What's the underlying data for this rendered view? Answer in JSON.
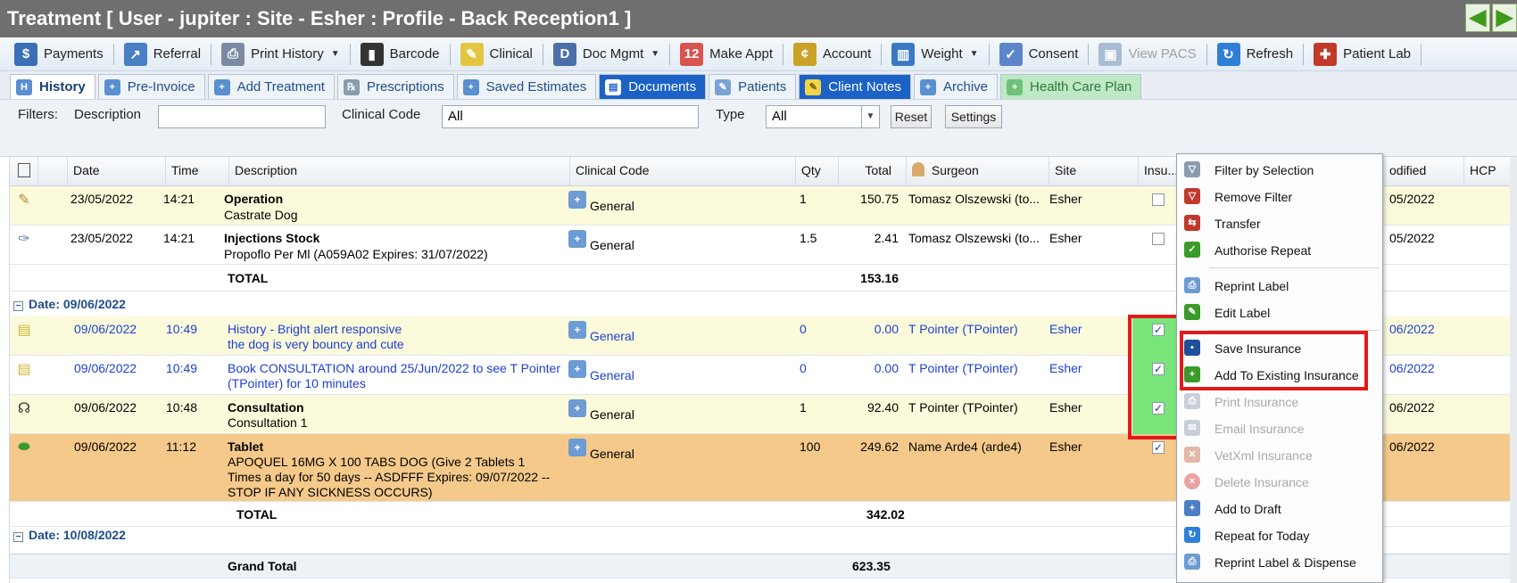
{
  "window": {
    "title": "Treatment [ User - jupiter : Site - Esher : Profile - Back Reception1 ]"
  },
  "toolbar": {
    "items": [
      {
        "label": "Payments",
        "icon": "payments-icon",
        "color": "#3b6fb6"
      },
      {
        "label": "Referral",
        "icon": "referral-icon",
        "color": "#4a7fc4"
      },
      {
        "label": "Print History",
        "icon": "print-history-icon",
        "color": "#7b8aa0"
      },
      {
        "label": "Barcode",
        "icon": "barcode-icon",
        "color": "#333333"
      },
      {
        "label": "Clinical",
        "icon": "clinical-notepad-icon",
        "color": "#e3c542"
      },
      {
        "label": "Doc Mgmt",
        "icon": "doc-mgmt-icon",
        "color": "#4b6fa8"
      },
      {
        "label": "Make Appt",
        "icon": "calendar-icon",
        "color": "#d9534f"
      },
      {
        "label": "Account",
        "icon": "account-coins-icon",
        "color": "#c9a227"
      },
      {
        "label": "Weight",
        "icon": "weight-chart-icon",
        "color": "#3a78c2"
      },
      {
        "label": "Consent",
        "icon": "consent-pen-icon",
        "color": "#5b86c9"
      },
      {
        "label": "View PACS",
        "icon": "pacs-image-icon",
        "color": "#a9bcd2"
      },
      {
        "label": "Refresh",
        "icon": "refresh-icon",
        "color": "#2f7fd6"
      },
      {
        "label": "Patient Lab",
        "icon": "patient-lab-icon",
        "color": "#c0392b"
      }
    ]
  },
  "tabs": [
    {
      "label": "History"
    },
    {
      "label": "Pre-Invoice"
    },
    {
      "label": "Add Treatment"
    },
    {
      "label": "Prescriptions"
    },
    {
      "label": "Saved Estimates"
    },
    {
      "label": "Documents"
    },
    {
      "label": "Patients"
    },
    {
      "label": "Client Notes"
    },
    {
      "label": "Archive"
    },
    {
      "label": "Health Care Plan"
    }
  ],
  "filters": {
    "label": "Filters:",
    "description_label": "Description",
    "description_value": "",
    "clinical_code_label": "Clinical Code",
    "clinical_code_value": "All",
    "type_label": "Type",
    "type_value": "All",
    "reset_label": "Reset",
    "settings_label": "Settings"
  },
  "grid": {
    "columns": [
      "Date",
      "Time",
      "Description",
      "Clinical Code",
      "Qty",
      "Total",
      "Surgeon",
      "Site",
      "Insu...",
      "odified",
      "HCP"
    ],
    "rows_group1": [
      {
        "date": "23/05/2022",
        "time": "14:21",
        "desc_title": "Operation",
        "desc_sub": "Castrate Dog",
        "code": "General",
        "qty": "1",
        "total": "150.75",
        "surgeon": "Tomasz Olszewski (to...",
        "site": "Esher",
        "modified": "05/2022"
      },
      {
        "date": "23/05/2022",
        "time": "14:21",
        "desc_title": "Injections Stock",
        "desc_sub": "Propoflo Per Ml (A059A02 Expires: 31/07/2022)",
        "code": "General",
        "qty": "1.5",
        "total": "2.41",
        "surgeon": "Tomasz Olszewski (to...",
        "site": "Esher",
        "modified": "05/2022"
      }
    ],
    "total1_label": "TOTAL",
    "total1_value": "153.16",
    "group2_label": "Date: 09/06/2022",
    "rows_group2": [
      {
        "date": "09/06/2022",
        "time": "10:49",
        "desc_line1": "History - Bright alert responsive",
        "desc_line2": "the dog is very bouncy and cute",
        "code": "General",
        "qty": "0",
        "total": "0.00",
        "surgeon": "T Pointer (TPointer)",
        "site": "Esher",
        "modified": "06/2022"
      },
      {
        "date": "09/06/2022",
        "time": "10:49",
        "desc_line1": "Book CONSULTATION around 25/Jun/2022 to see T Pointer",
        "desc_line2": "(TPointer) for 10 minutes",
        "code": "General",
        "qty": "0",
        "total": "0.00",
        "surgeon": "T Pointer (TPointer)",
        "site": "Esher",
        "modified": "06/2022"
      },
      {
        "date": "09/06/2022",
        "time": "10:48",
        "desc_title": "Consultation",
        "desc_sub": "Consultation 1",
        "code": "General",
        "qty": "1",
        "total": "92.40",
        "surgeon": "T Pointer (TPointer)",
        "site": "Esher",
        "modified": "06/2022"
      },
      {
        "date": "09/06/2022",
        "time": "11:12",
        "desc_title": "Tablet",
        "desc_l1": "APOQUEL 16MG X 100 TABS DOG (Give 2 Tablets 1",
        "desc_l2": "Times a day for 50 days -- ASDFFF Expires: 09/07/2022 --",
        "desc_l3": "STOP IF ANY SICKNESS OCCURS)",
        "code": "General",
        "qty": "100",
        "total": "249.62",
        "surgeon": "Name Arde4 (arde4)",
        "site": "Esher",
        "modified": "06/2022"
      }
    ],
    "total2_label": "TOTAL",
    "total2_value": "342.02",
    "group3_label": "Date: 10/08/2022",
    "grand_total_label": "Grand Total",
    "grand_total_value": "623.35"
  },
  "context_menu": {
    "items": [
      {
        "label": "Filter by Selection",
        "icon": "filter-selection-icon",
        "enabled": true
      },
      {
        "label": "Remove Filter",
        "icon": "remove-filter-icon",
        "enabled": true
      },
      {
        "label": "Transfer",
        "icon": "transfer-truck-icon",
        "enabled": true
      },
      {
        "label": "Authorise Repeat",
        "icon": "authorise-repeat-icon",
        "enabled": true
      },
      {
        "label": "Reprint Label",
        "icon": "reprint-label-icon",
        "enabled": true
      },
      {
        "label": "Edit Label",
        "icon": "edit-label-icon",
        "enabled": true
      },
      {
        "label": "Save Insurance",
        "icon": "save-disk-icon",
        "enabled": true
      },
      {
        "label": "Add To Existing Insurance",
        "icon": "add-insurance-icon",
        "enabled": true
      },
      {
        "label": "Print Insurance",
        "icon": "print-insurance-icon",
        "enabled": false
      },
      {
        "label": "Email Insurance",
        "icon": "email-insurance-icon",
        "enabled": false
      },
      {
        "label": "VetXml Insurance",
        "icon": "vetxml-icon",
        "enabled": false
      },
      {
        "label": "Delete Insurance",
        "icon": "delete-icon",
        "enabled": false
      },
      {
        "label": "Add to Draft",
        "icon": "add-draft-icon",
        "enabled": true
      },
      {
        "label": "Repeat for Today",
        "icon": "repeat-today-icon",
        "enabled": true
      },
      {
        "label": "Reprint Label & Dispense",
        "icon": "reprint-dispense-icon",
        "enabled": true
      }
    ]
  },
  "colors": {
    "highlight_green": "#7ae57a",
    "annotation_red": "#e11b1b",
    "row_yellow": "#fbfbdc",
    "row_orange": "#f5c98a",
    "link_blue": "#1d3fd0"
  }
}
